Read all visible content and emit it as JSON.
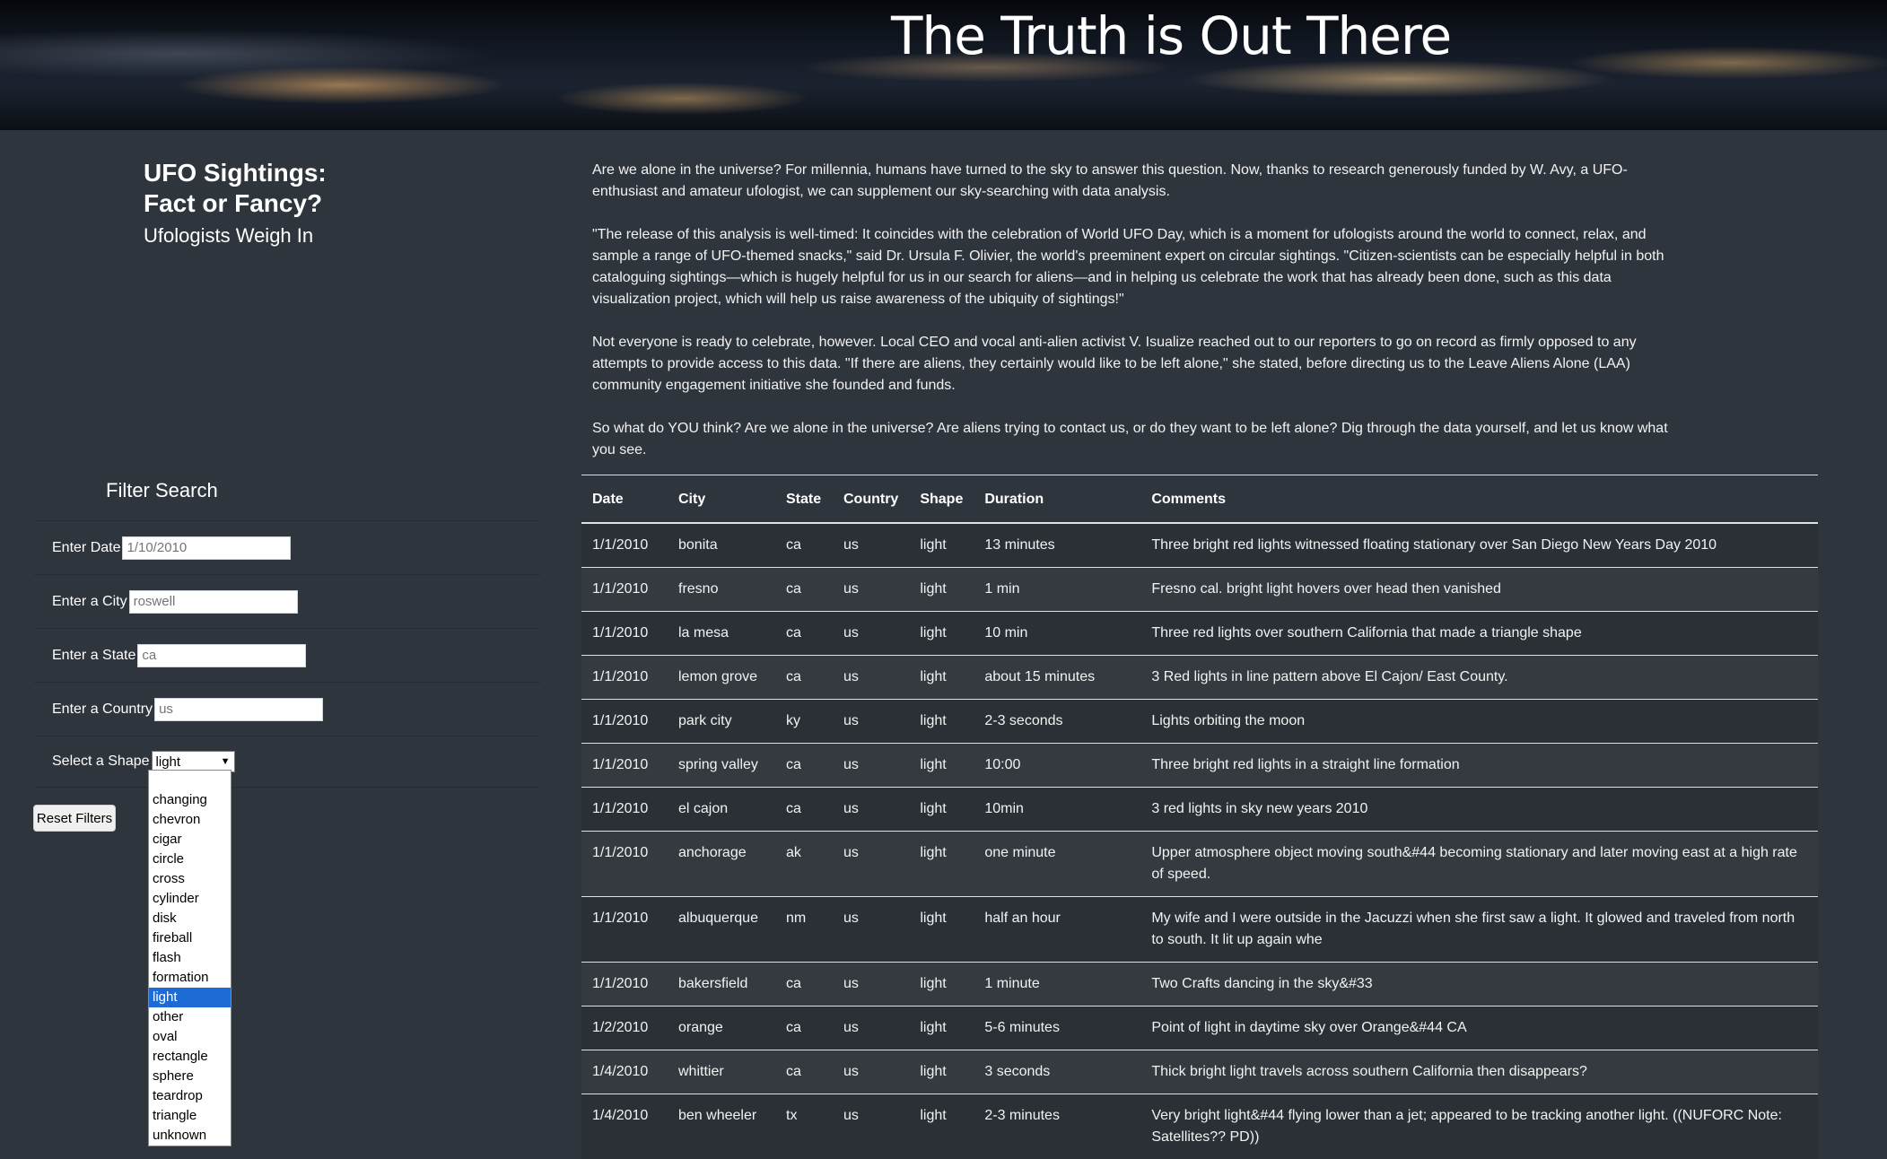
{
  "banner": {
    "title": "The Truth is Out There"
  },
  "heading": {
    "line1": "UFO Sightings:",
    "line2": "Fact or Fancy?",
    "subtitle": "Ufologists Weigh In"
  },
  "intro": [
    "Are we alone in the universe? For millennia, humans have turned to the sky to answer this question. Now, thanks to research generously funded by W. Avy, a UFO-enthusiast and amateur ufologist, we can supplement our sky-searching with data analysis.",
    "\"The release of this analysis is well-timed: It coincides with the celebration of World UFO Day, which is a moment for ufologists around the world to connect, relax, and sample a range of UFO-themed snacks,\" said Dr. Ursula F. Olivier, the world's preeminent expert on circular sightings. \"Citizen-scientists can be especially helpful in both cataloguing sightings—which is hugely helpful for us in our search for aliens—and in helping us celebrate the work that has already been done, such as this data visualization project, which will help us raise awareness of the ubiquity of sightings!\"",
    "Not everyone is ready to celebrate, however. Local CEO and vocal anti-alien activist V. Isualize reached out to our reporters to go on record as firmly opposed to any attempts to provide access to this data. \"If there are aliens, they certainly would like to be left alone,\" she stated, before directing us to the Leave Aliens Alone (LAA) community engagement initiative she founded and funds.",
    "So what do YOU think? Are we alone in the universe? Are aliens trying to contact us, or do they want to be left alone? Dig through the data yourself, and let us know what you see."
  ],
  "filters": {
    "title": "Filter Search",
    "date": {
      "label": "Enter Date",
      "placeholder": "1/10/2010"
    },
    "city": {
      "label": "Enter a City",
      "placeholder": "roswell"
    },
    "state": {
      "label": "Enter a State",
      "placeholder": "ca"
    },
    "country": {
      "label": "Enter a Country",
      "placeholder": "us"
    },
    "shape": {
      "label": "Select a Shape",
      "selected": "light",
      "options": [
        "",
        "changing",
        "chevron",
        "cigar",
        "circle",
        "cross",
        "cylinder",
        "disk",
        "fireball",
        "flash",
        "formation",
        "light",
        "other",
        "oval",
        "rectangle",
        "sphere",
        "teardrop",
        "triangle",
        "unknown"
      ]
    },
    "reset_label": "Reset Filters"
  },
  "table": {
    "headers": [
      "Date",
      "City",
      "State",
      "Country",
      "Shape",
      "Duration",
      "Comments"
    ],
    "rows": [
      [
        "1/1/2010",
        "bonita",
        "ca",
        "us",
        "light",
        "13 minutes",
        "Three bright red lights witnessed floating stationary over San Diego New Years Day 2010"
      ],
      [
        "1/1/2010",
        "fresno",
        "ca",
        "us",
        "light",
        "1 min",
        "Fresno cal. bright light hovers over head then vanished"
      ],
      [
        "1/1/2010",
        "la mesa",
        "ca",
        "us",
        "light",
        "10 min",
        "Three red lights over southern California that made a triangle shape"
      ],
      [
        "1/1/2010",
        "lemon grove",
        "ca",
        "us",
        "light",
        "about 15 minutes",
        "3 Red lights in line pattern above El Cajon/ East County."
      ],
      [
        "1/1/2010",
        "park city",
        "ky",
        "us",
        "light",
        "2-3 seconds",
        "Lights orbiting the moon"
      ],
      [
        "1/1/2010",
        "spring valley",
        "ca",
        "us",
        "light",
        "10:00",
        "Three bright red lights in a straight line formation"
      ],
      [
        "1/1/2010",
        "el cajon",
        "ca",
        "us",
        "light",
        "10min",
        "3 red lights in sky new years 2010"
      ],
      [
        "1/1/2010",
        "anchorage",
        "ak",
        "us",
        "light",
        "one minute",
        "Upper atmosphere object moving south&#44 becoming stationary and later moving east at a high rate of speed."
      ],
      [
        "1/1/2010",
        "albuquerque",
        "nm",
        "us",
        "light",
        "half an hour",
        "My wife and I were outside in the Jacuzzi when she first saw a light. It glowed and traveled from north to south. It lit up again whe"
      ],
      [
        "1/1/2010",
        "bakersfield",
        "ca",
        "us",
        "light",
        "1 minute",
        "Two Crafts dancing in the sky&#33"
      ],
      [
        "1/2/2010",
        "orange",
        "ca",
        "us",
        "light",
        "5-6 minutes",
        "Point of light in daytime sky over Orange&#44 CA"
      ],
      [
        "1/4/2010",
        "whittier",
        "ca",
        "us",
        "light",
        "3 seconds",
        "Thick bright light travels across southern California then disappears?"
      ],
      [
        "1/4/2010",
        "ben wheeler",
        "tx",
        "us",
        "light",
        "2-3 minutes",
        "Very bright light&#44 flying lower than a jet; appeared to be tracking another light. ((NUFORC Note: Satellites?? PD))"
      ]
    ]
  }
}
